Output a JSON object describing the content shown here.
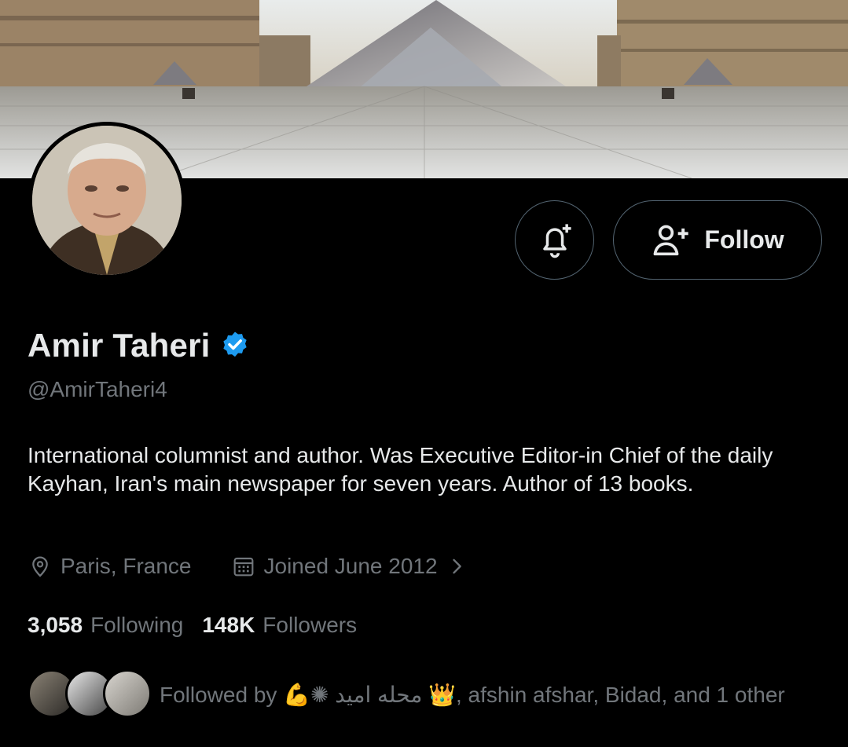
{
  "profile": {
    "name": "Amir Taheri",
    "handle": "@AmirTaheri4",
    "bio": "International columnist and author. Was Executive Editor-in Chief of the daily Kayhan, Iran's main newspaper for seven years. Author of 13 books.",
    "location": "Paris, France",
    "joined": "Joined June 2012",
    "verified": true
  },
  "actions": {
    "follow_label": "Follow"
  },
  "stats": {
    "following_count": "3,058",
    "following_label": "Following",
    "followers_count": "148K",
    "followers_label": "Followers"
  },
  "followed_by": {
    "text": "Followed by 💪✺ محله امید 👑, afshin afshar, Bidad, and 1 other"
  },
  "colors": {
    "background": "#000000",
    "text_primary": "#e7e9ea",
    "text_secondary": "#71767b",
    "border": "#536471",
    "verified_blue": "#1d9bf0"
  },
  "icons": {
    "notification": "bell-plus-icon",
    "follow": "person-plus-icon",
    "verified": "verified-badge-icon",
    "location": "location-pin-icon",
    "calendar": "calendar-icon",
    "chevron": "chevron-right-icon"
  }
}
